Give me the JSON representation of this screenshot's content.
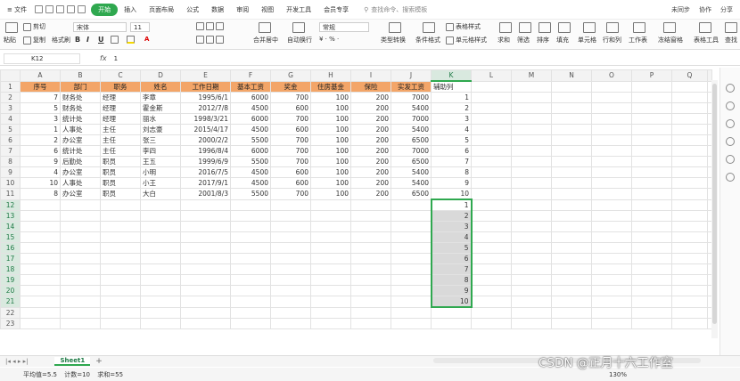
{
  "menubar": {
    "file": "文件",
    "tabs": [
      "开始",
      "插入",
      "页面布局",
      "公式",
      "数据",
      "审阅",
      "视图",
      "开发工具",
      "会员专享"
    ],
    "active_tab": "开始",
    "search_placeholder": "查找命令、搜索模板",
    "right": [
      "未同步",
      "协作",
      "分享"
    ]
  },
  "ribbon": {
    "paste": "粘贴",
    "cut": "剪切",
    "copy": "复制",
    "format_painter": "格式刷",
    "font_name": "宋体",
    "font_size": "11",
    "bold": "B",
    "italic": "I",
    "underline": "U",
    "merge": "合并居中",
    "wrap": "自动换行",
    "number_format": "常规",
    "type_convert": "类型转换",
    "cond_format": "条件格式",
    "table_style": "表格样式",
    "cell_style": "单元格样式",
    "sum": "求和",
    "filter": "筛选",
    "sort": "排序",
    "fill": "填充",
    "cell": "单元格",
    "rowcol": "行和列",
    "worksheet": "工作表",
    "freeze": "冻结窗格",
    "table_tools": "表格工具",
    "find": "查找"
  },
  "formula_bar": {
    "cell_ref": "K12",
    "fx": "fx",
    "value": "1"
  },
  "grid": {
    "columns": [
      "A",
      "B",
      "C",
      "D",
      "E",
      "F",
      "G",
      "H",
      "I",
      "J",
      "K",
      "L",
      "M",
      "N",
      "O",
      "P",
      "Q"
    ],
    "selected_column": "K",
    "headers": [
      "序号",
      "部门",
      "职务",
      "姓名",
      "工作日期",
      "基本工资",
      "奖金",
      "住房基金",
      "保险",
      "实发工资",
      "辅助列"
    ],
    "rows": [
      [
        "7",
        "财务处",
        "经理",
        "李章",
        "1995/6/1",
        "6000",
        "700",
        "100",
        "200",
        "7000",
        "1"
      ],
      [
        "5",
        "财务处",
        "经理",
        "霍金斯",
        "2012/7/8",
        "4500",
        "600",
        "100",
        "200",
        "5400",
        "2"
      ],
      [
        "3",
        "统计处",
        "经理",
        "丽水",
        "1998/3/21",
        "6000",
        "700",
        "100",
        "200",
        "7000",
        "3"
      ],
      [
        "1",
        "人事处",
        "主任",
        "刘志豪",
        "2015/4/17",
        "4500",
        "600",
        "100",
        "200",
        "5400",
        "4"
      ],
      [
        "2",
        "办公室",
        "主任",
        "张三",
        "2000/2/2",
        "5500",
        "700",
        "100",
        "200",
        "6500",
        "5"
      ],
      [
        "6",
        "统计处",
        "主任",
        "李四",
        "1996/8/4",
        "6000",
        "700",
        "100",
        "200",
        "7000",
        "6"
      ],
      [
        "9",
        "后勤处",
        "职员",
        "王五",
        "1999/6/9",
        "5500",
        "700",
        "100",
        "200",
        "6500",
        "7"
      ],
      [
        "4",
        "办公室",
        "职员",
        "小明",
        "2016/7/5",
        "4500",
        "600",
        "100",
        "200",
        "5400",
        "8"
      ],
      [
        "10",
        "人事处",
        "职员",
        "小王",
        "2017/9/1",
        "4500",
        "600",
        "100",
        "200",
        "5400",
        "9"
      ],
      [
        "8",
        "办公室",
        "职员",
        "大白",
        "2001/8/3",
        "5500",
        "700",
        "100",
        "200",
        "6500",
        "10"
      ]
    ],
    "helper_values": [
      "1",
      "2",
      "3",
      "4",
      "5",
      "6",
      "7",
      "8",
      "9",
      "10"
    ],
    "row_count": 23
  },
  "sheet_tabs": {
    "active": "Sheet1",
    "add": "+"
  },
  "status": {
    "average": "平均值=5.5",
    "count": "计数=10",
    "sum": "求和=55",
    "zoom": "130%"
  },
  "watermark": "CSDN @正月十六工作室"
}
